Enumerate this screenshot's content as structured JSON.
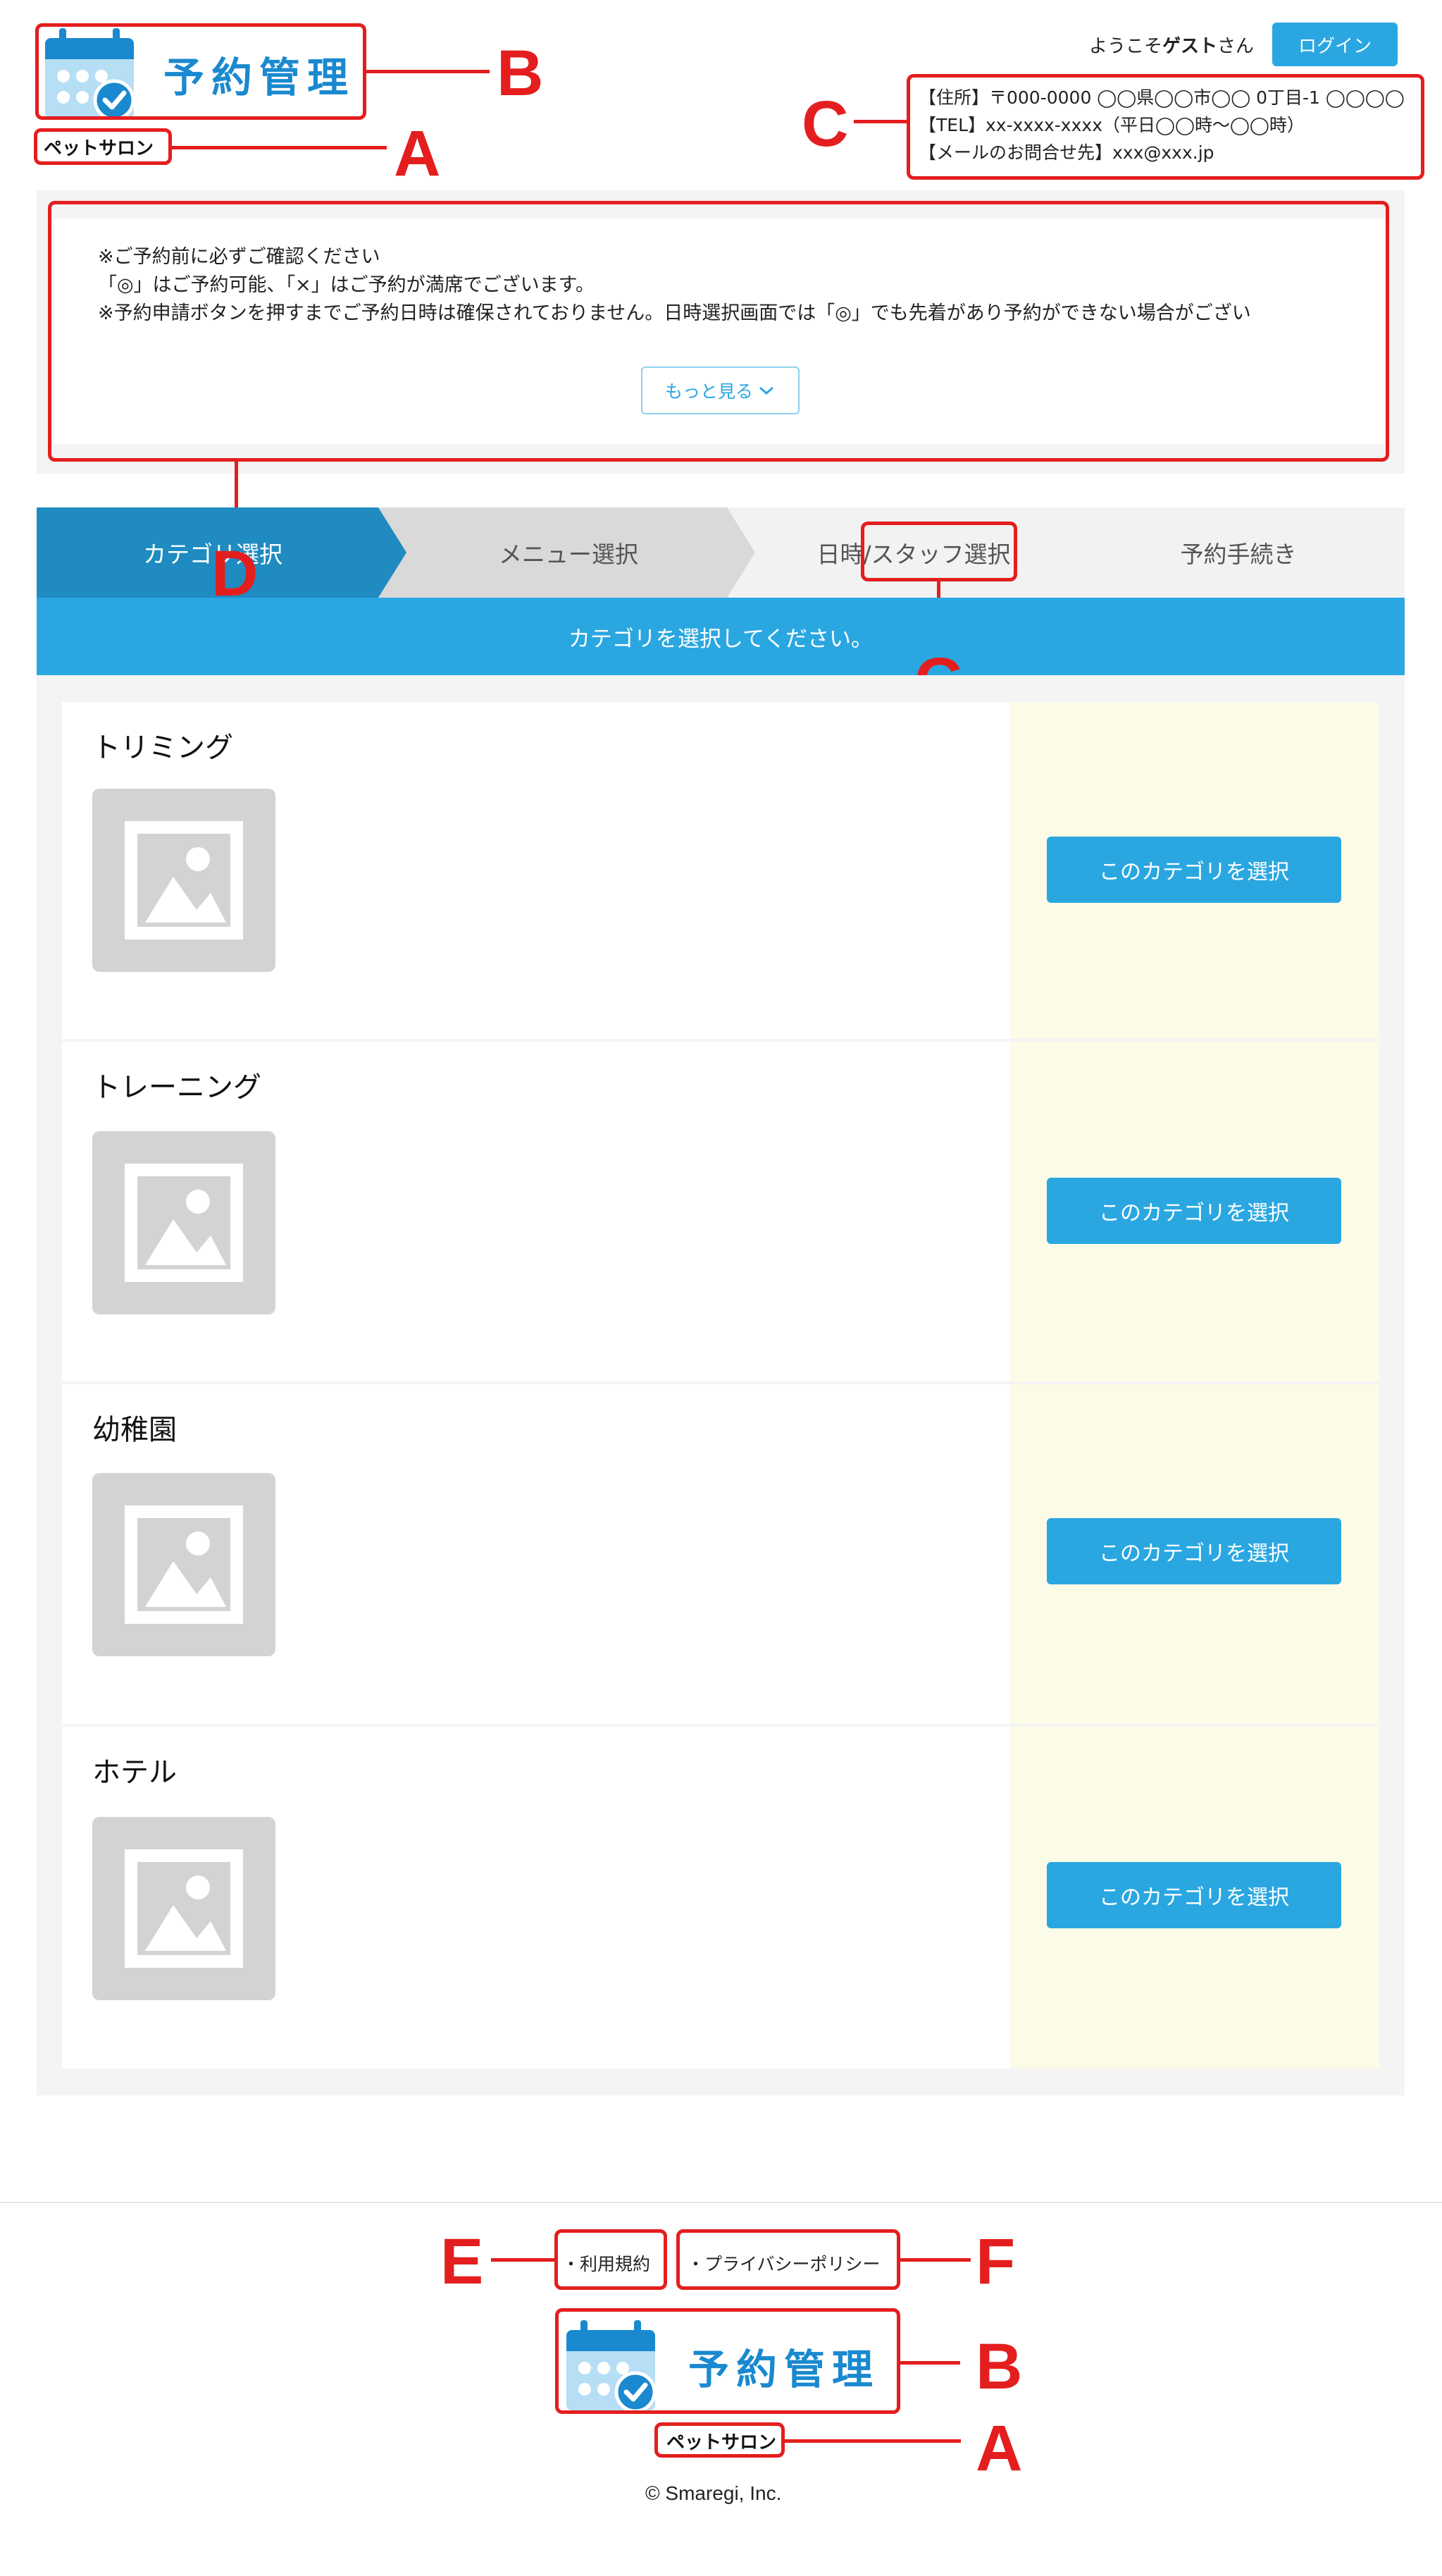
{
  "header": {
    "app_title": "予約管理",
    "shop_name": "ペットサロン",
    "welcome_prefix": "ようこそ",
    "welcome_user": "ゲスト",
    "welcome_suffix": "さん",
    "login_label": "ログイン",
    "contact": {
      "address": "【住所】〒000-0000 ◯◯県◯◯市◯◯ 0丁目-1 ◯◯◯◯",
      "tel": "【TEL】xx-xxxx-xxxx（平日◯◯時〜◯◯時）",
      "email": "【メールのお問合せ先】xxx@xxx.jp"
    }
  },
  "notice": {
    "lines": [
      "※ご予約前に必ずご確認ください",
      "「◎」はご予約可能、「×」はご予約が満席でございます。",
      "※予約申請ボタンを押すまでご予約日時は確保されておりません。日時選択画面では「◎」でも先着があり予約ができない場合がござい"
    ],
    "more_label": "もっと見る"
  },
  "steps": [
    {
      "label": "カテゴリ選択",
      "state": "active"
    },
    {
      "label": "メニュー選択",
      "state": "next"
    },
    {
      "label": "日時/スタッフ選択",
      "state": "pending"
    },
    {
      "label": "予約手続き",
      "state": "pending"
    }
  ],
  "instruction": "カテゴリを選択してください。",
  "categories": [
    {
      "name": "トリミング",
      "button": "このカテゴリを選択"
    },
    {
      "name": "トレーニング",
      "button": "このカテゴリを選択"
    },
    {
      "name": "幼稚園",
      "button": "このカテゴリを選択"
    },
    {
      "name": "ホテル",
      "button": "このカテゴリを選択"
    }
  ],
  "footer": {
    "terms": "・利用規約",
    "privacy": "・プライバシーポリシー",
    "app_title": "予約管理",
    "shop_name": "ペットサロン",
    "copyright": "© Smaregi, Inc."
  },
  "annotations": {
    "shop_name": "A",
    "logo": "B",
    "contact": "C",
    "notice": "D",
    "terms": "E",
    "privacy": "F",
    "step": "G"
  },
  "colors": {
    "accent": "#2aa7e1",
    "step_active": "#1f8bc0",
    "step_next": "#d9d9d9",
    "logo_blue": "#1a89cf",
    "button_panel": "#fbfbe8",
    "annotation_red": "#e41e1e"
  }
}
